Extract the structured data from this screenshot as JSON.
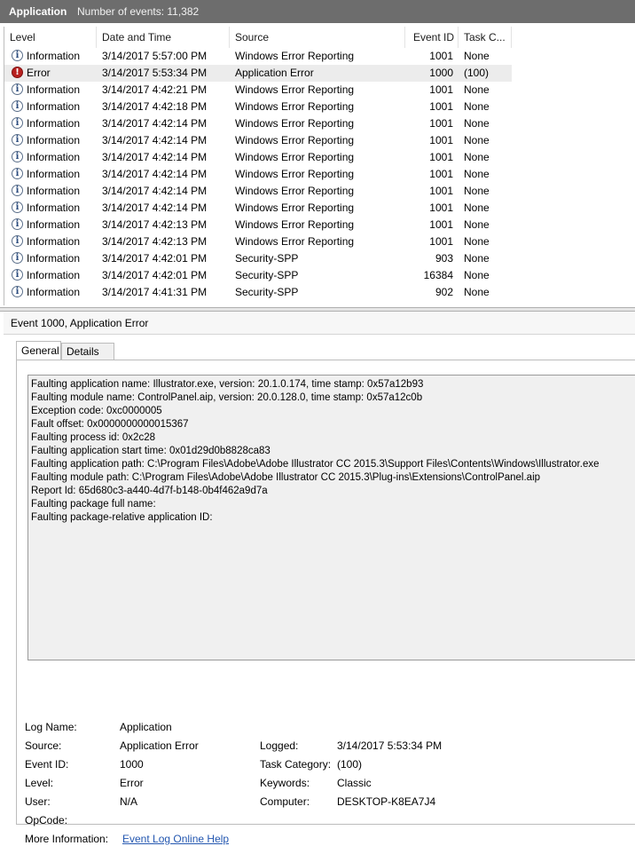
{
  "header": {
    "log_name": "Application",
    "event_count": "Number of events: 11,382"
  },
  "columns": [
    "Level",
    "Date and Time",
    "Source",
    "Event ID",
    "Task C..."
  ],
  "events": [
    {
      "level": "Information",
      "type": "info",
      "datetime": "3/14/2017 5:57:00 PM",
      "source": "Windows Error Reporting",
      "event_id": "1001",
      "task": "None"
    },
    {
      "level": "Error",
      "type": "error",
      "datetime": "3/14/2017 5:53:34 PM",
      "source": "Application Error",
      "event_id": "1000",
      "task": "(100)",
      "selected": true
    },
    {
      "level": "Information",
      "type": "info",
      "datetime": "3/14/2017 4:42:21 PM",
      "source": "Windows Error Reporting",
      "event_id": "1001",
      "task": "None"
    },
    {
      "level": "Information",
      "type": "info",
      "datetime": "3/14/2017 4:42:18 PM",
      "source": "Windows Error Reporting",
      "event_id": "1001",
      "task": "None"
    },
    {
      "level": "Information",
      "type": "info",
      "datetime": "3/14/2017 4:42:14 PM",
      "source": "Windows Error Reporting",
      "event_id": "1001",
      "task": "None"
    },
    {
      "level": "Information",
      "type": "info",
      "datetime": "3/14/2017 4:42:14 PM",
      "source": "Windows Error Reporting",
      "event_id": "1001",
      "task": "None"
    },
    {
      "level": "Information",
      "type": "info",
      "datetime": "3/14/2017 4:42:14 PM",
      "source": "Windows Error Reporting",
      "event_id": "1001",
      "task": "None"
    },
    {
      "level": "Information",
      "type": "info",
      "datetime": "3/14/2017 4:42:14 PM",
      "source": "Windows Error Reporting",
      "event_id": "1001",
      "task": "None"
    },
    {
      "level": "Information",
      "type": "info",
      "datetime": "3/14/2017 4:42:14 PM",
      "source": "Windows Error Reporting",
      "event_id": "1001",
      "task": "None"
    },
    {
      "level": "Information",
      "type": "info",
      "datetime": "3/14/2017 4:42:14 PM",
      "source": "Windows Error Reporting",
      "event_id": "1001",
      "task": "None"
    },
    {
      "level": "Information",
      "type": "info",
      "datetime": "3/14/2017 4:42:13 PM",
      "source": "Windows Error Reporting",
      "event_id": "1001",
      "task": "None"
    },
    {
      "level": "Information",
      "type": "info",
      "datetime": "3/14/2017 4:42:13 PM",
      "source": "Windows Error Reporting",
      "event_id": "1001",
      "task": "None"
    },
    {
      "level": "Information",
      "type": "info",
      "datetime": "3/14/2017 4:42:01 PM",
      "source": "Security-SPP",
      "event_id": "903",
      "task": "None"
    },
    {
      "level": "Information",
      "type": "info",
      "datetime": "3/14/2017 4:42:01 PM",
      "source": "Security-SPP",
      "event_id": "16384",
      "task": "None"
    },
    {
      "level": "Information",
      "type": "info",
      "datetime": "3/14/2017 4:41:31 PM",
      "source": "Security-SPP",
      "event_id": "902",
      "task": "None"
    }
  ],
  "detail": {
    "title": "Event 1000, Application Error",
    "tabs": [
      "General",
      "Details"
    ],
    "message_lines": [
      "Faulting application name: Illustrator.exe, version: 20.1.0.174, time stamp: 0x57a12b93",
      "Faulting module name: ControlPanel.aip, version: 20.0.128.0, time stamp: 0x57a12c0b",
      "Exception code: 0xc0000005",
      "Fault offset: 0x0000000000015367",
      "Faulting process id: 0x2c28",
      "Faulting application start time: 0x01d29d0b8828ca83",
      "Faulting application path: C:\\Program Files\\Adobe\\Adobe Illustrator CC 2015.3\\Support Files\\Contents\\Windows\\Illustrator.exe",
      "Faulting module path: C:\\Program Files\\Adobe\\Adobe Illustrator CC 2015.3\\Plug-ins\\Extensions\\ControlPanel.aip",
      "Report Id: 65d680c3-a440-4d7f-b148-0b4f462a9d7a",
      "Faulting package full name:",
      "Faulting package-relative application ID:"
    ],
    "props": {
      "log_name_label": "Log Name:",
      "log_name": "Application",
      "source_label": "Source:",
      "source": "Application Error",
      "logged_label": "Logged:",
      "logged": "3/14/2017 5:53:34 PM",
      "event_id_label": "Event ID:",
      "event_id": "1000",
      "task_category_label": "Task Category:",
      "task_category": "(100)",
      "level_label": "Level:",
      "level": "Error",
      "keywords_label": "Keywords:",
      "keywords": "Classic",
      "user_label": "User:",
      "user": "N/A",
      "computer_label": "Computer:",
      "computer": "DESKTOP-K8EA7J4",
      "opcode_label": "OpCode:",
      "more_info_label": "More Information:",
      "more_info_link": "Event Log Online Help"
    }
  }
}
